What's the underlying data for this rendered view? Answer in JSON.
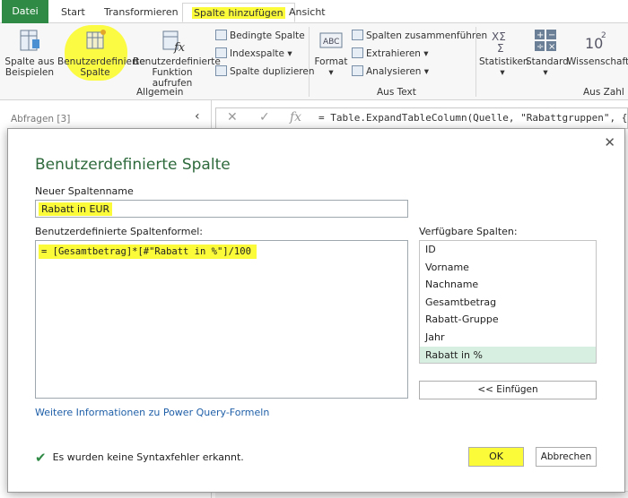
{
  "ribbon": {
    "tabs": [
      "Datei",
      "Start",
      "Transformieren",
      "Spalte hinzufügen",
      "Ansicht"
    ],
    "groups": {
      "allgemein": {
        "label": "Allgemein",
        "spalte_aus_beispielen": "Spalte aus Beispielen",
        "benutzerdefinierte_spalte": "Benutzerdefinierte Spalte",
        "benutzerdefinierte_funktion": "Benutzerdefinierte Funktion aufrufen",
        "bedingte_spalte": "Bedingte Spalte",
        "indexspalte": "Indexspalte",
        "spalte_duplizieren": "Spalte duplizieren"
      },
      "aus_text": {
        "label": "Aus Text",
        "format": "Format",
        "spalten_zusammenfuehren": "Spalten zusammenführen",
        "extrahieren": "Extrahieren",
        "analysieren": "Analysieren"
      },
      "aus_zahl": {
        "label": "Aus Zahl",
        "statistiken": "Statistiken",
        "standard": "Standard",
        "wissenschaftlich": "Wissenschaftlich"
      }
    }
  },
  "left_pane": {
    "queries_title": "Abfragen [3]"
  },
  "formula_bar": {
    "text": "= Table.ExpandTableColumn(Quelle, \"Rabattgruppen\", {\""
  },
  "dialog": {
    "title": "Benutzerdefinierte Spalte",
    "new_column_label": "Neuer Spaltenname",
    "new_column_value": "Rabatt in EUR",
    "formula_label": "Benutzerdefinierte Spaltenformel:",
    "formula_value": "= [Gesamtbetrag]*[#\"Rabatt in %\"]/100",
    "available_label": "Verfügbare Spalten:",
    "columns": [
      "ID",
      "Vorname",
      "Nachname",
      "Gesamtbetrag",
      "Rabatt-Gruppe",
      "Jahr",
      "Rabatt in %"
    ],
    "insert_button": "<< Einfügen",
    "info_link": "Weitere Informationen zu Power Query-Formeln",
    "status": "Es wurden keine Syntaxfehler erkannt.",
    "ok": "OK",
    "cancel": "Abbrechen"
  }
}
